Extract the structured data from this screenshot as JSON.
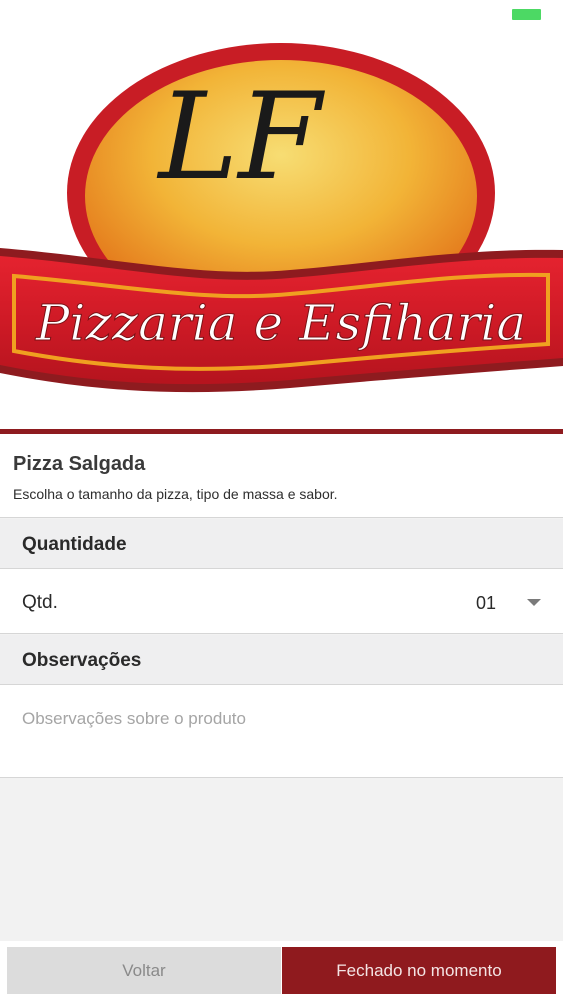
{
  "banner": {
    "monogram": "LF",
    "brand_text": "Pizzaria e Esfiharia",
    "colors": {
      "red": "#d21f2c",
      "dark_red": "#8e1b1f",
      "orange": "#f0a020",
      "gold": "#f5d56a"
    }
  },
  "product": {
    "title": "Pizza Salgada",
    "description": "Escolha o tamanho da pizza, tipo de massa e sabor."
  },
  "quantity_section": {
    "header": "Quantidade",
    "label": "Qtd.",
    "value": "01"
  },
  "observations_section": {
    "header": "Observações",
    "placeholder": "Observações sobre o produto"
  },
  "footer": {
    "back_label": "Voltar",
    "closed_label": "Fechado no momento"
  },
  "status": {
    "battery_color": "#4cd964"
  }
}
